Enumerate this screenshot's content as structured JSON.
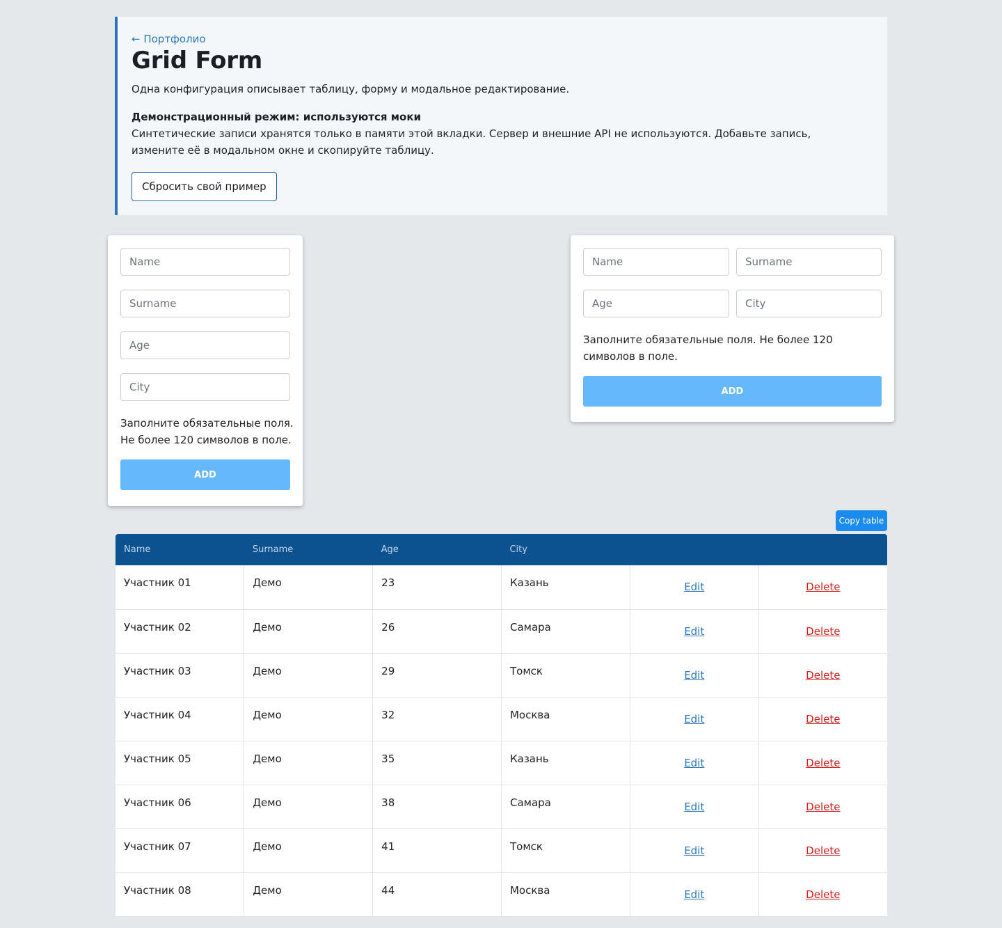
{
  "header": {
    "back_link": "← Портфолио",
    "title": "Grid Form",
    "lead": "Одна конфигурация описывает таблицу, форму и модальное редактирование.",
    "demo_title": "Демонстрационный режим: используются моки",
    "demo_text": "Синтетические записи хранятся только в памяти этой вкладки. Сервер и внешние API не используются. Добавьте запись, измените её в модальном окне и скопируйте таблицу.",
    "reset_button": "Сбросить свой пример"
  },
  "form_left": {
    "name_placeholder": "Name",
    "surname_placeholder": "Surname",
    "age_placeholder": "Age",
    "city_placeholder": "City",
    "hint_line1": "Заполните обязательные поля.",
    "hint_line2": "Не более 120 символов в поле.",
    "add_label": "ADD"
  },
  "form_right": {
    "name_placeholder": "Name",
    "surname_placeholder": "Surname",
    "age_placeholder": "Age",
    "city_placeholder": "City",
    "hint": "Заполните обязательные поля. Не более 120 символов в поле.",
    "add_label": "ADD"
  },
  "copy_table_label": "Copy table",
  "table": {
    "headers": [
      "Name",
      "Surname",
      "Age",
      "City",
      "",
      ""
    ],
    "edit_label": "Edit",
    "delete_label": "Delete",
    "rows": [
      {
        "name": "Участник 01",
        "surname": "Демо",
        "age": "23",
        "city": "Казань"
      },
      {
        "name": "Участник 02",
        "surname": "Демо",
        "age": "26",
        "city": "Самара"
      },
      {
        "name": "Участник 03",
        "surname": "Демо",
        "age": "29",
        "city": "Томск"
      },
      {
        "name": "Участник 04",
        "surname": "Демо",
        "age": "32",
        "city": "Москва"
      },
      {
        "name": "Участник 05",
        "surname": "Демо",
        "age": "35",
        "city": "Казань"
      },
      {
        "name": "Участник 06",
        "surname": "Демо",
        "age": "38",
        "city": "Самара"
      },
      {
        "name": "Участник 07",
        "surname": "Демо",
        "age": "41",
        "city": "Томск"
      },
      {
        "name": "Участник 08",
        "surname": "Демо",
        "age": "44",
        "city": "Москва"
      }
    ]
  },
  "colors": {
    "accent_border": "#2f6fc0",
    "table_header_bg": "#0c5190",
    "add_button_bg": "#66b8fd",
    "copy_button_bg": "#1a8cf0",
    "delete_link": "#d21f1f",
    "edit_link": "#2f78b7"
  }
}
